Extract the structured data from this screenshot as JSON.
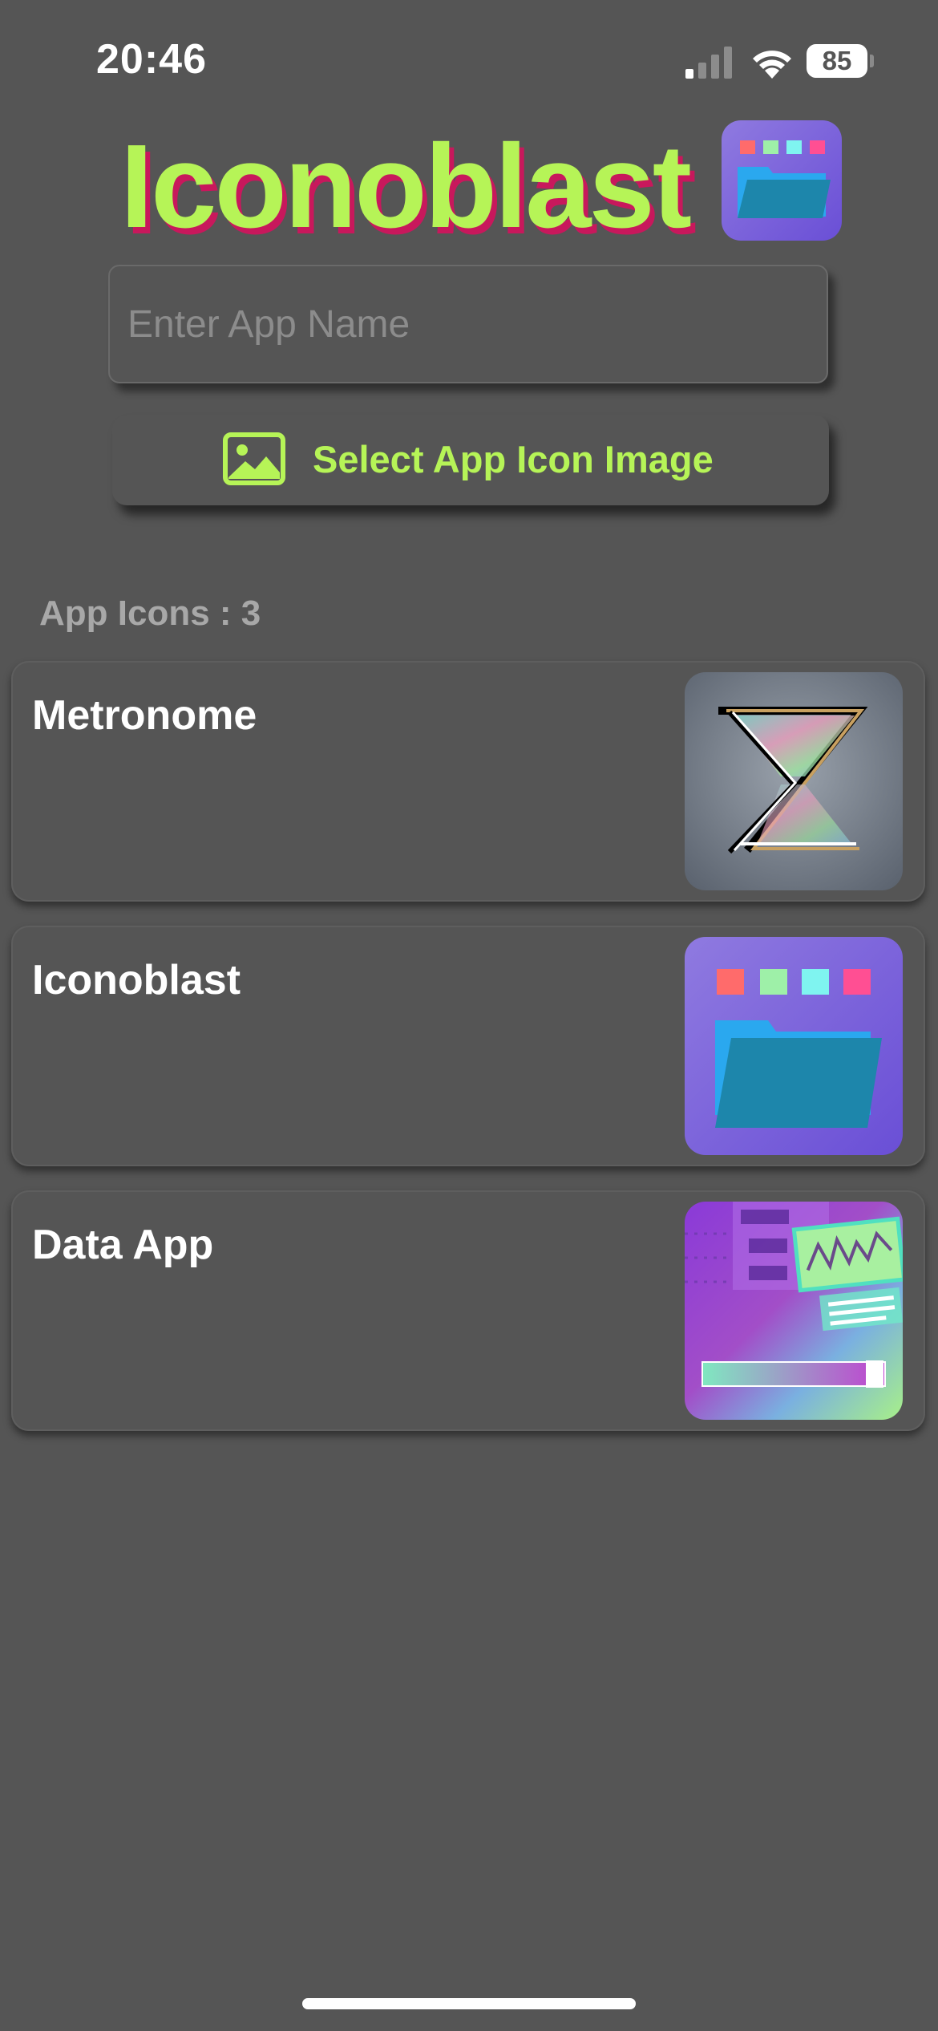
{
  "status_bar": {
    "time": "20:46",
    "battery_percent": "85",
    "signal_bars_active": 1,
    "signal_bars_total": 4
  },
  "header": {
    "title": "Iconoblast",
    "title_color": "#b6f457",
    "title_shadow_color": "#c8185c",
    "app_icon": "folder-with-color-squares-icon"
  },
  "form": {
    "app_name_placeholder": "Enter App Name",
    "app_name_value": "",
    "select_button_label": "Select App Icon Image",
    "select_button_icon": "photo-icon"
  },
  "list": {
    "count_label": "App Icons : 3",
    "items": [
      {
        "name": "Metronome",
        "icon": "hourglass-icon"
      },
      {
        "name": "Iconoblast",
        "icon": "folder-with-color-squares-icon"
      },
      {
        "name": "Data App",
        "icon": "data-chart-icon"
      }
    ]
  },
  "colors": {
    "background": "#555555",
    "accent": "#b6f457"
  }
}
